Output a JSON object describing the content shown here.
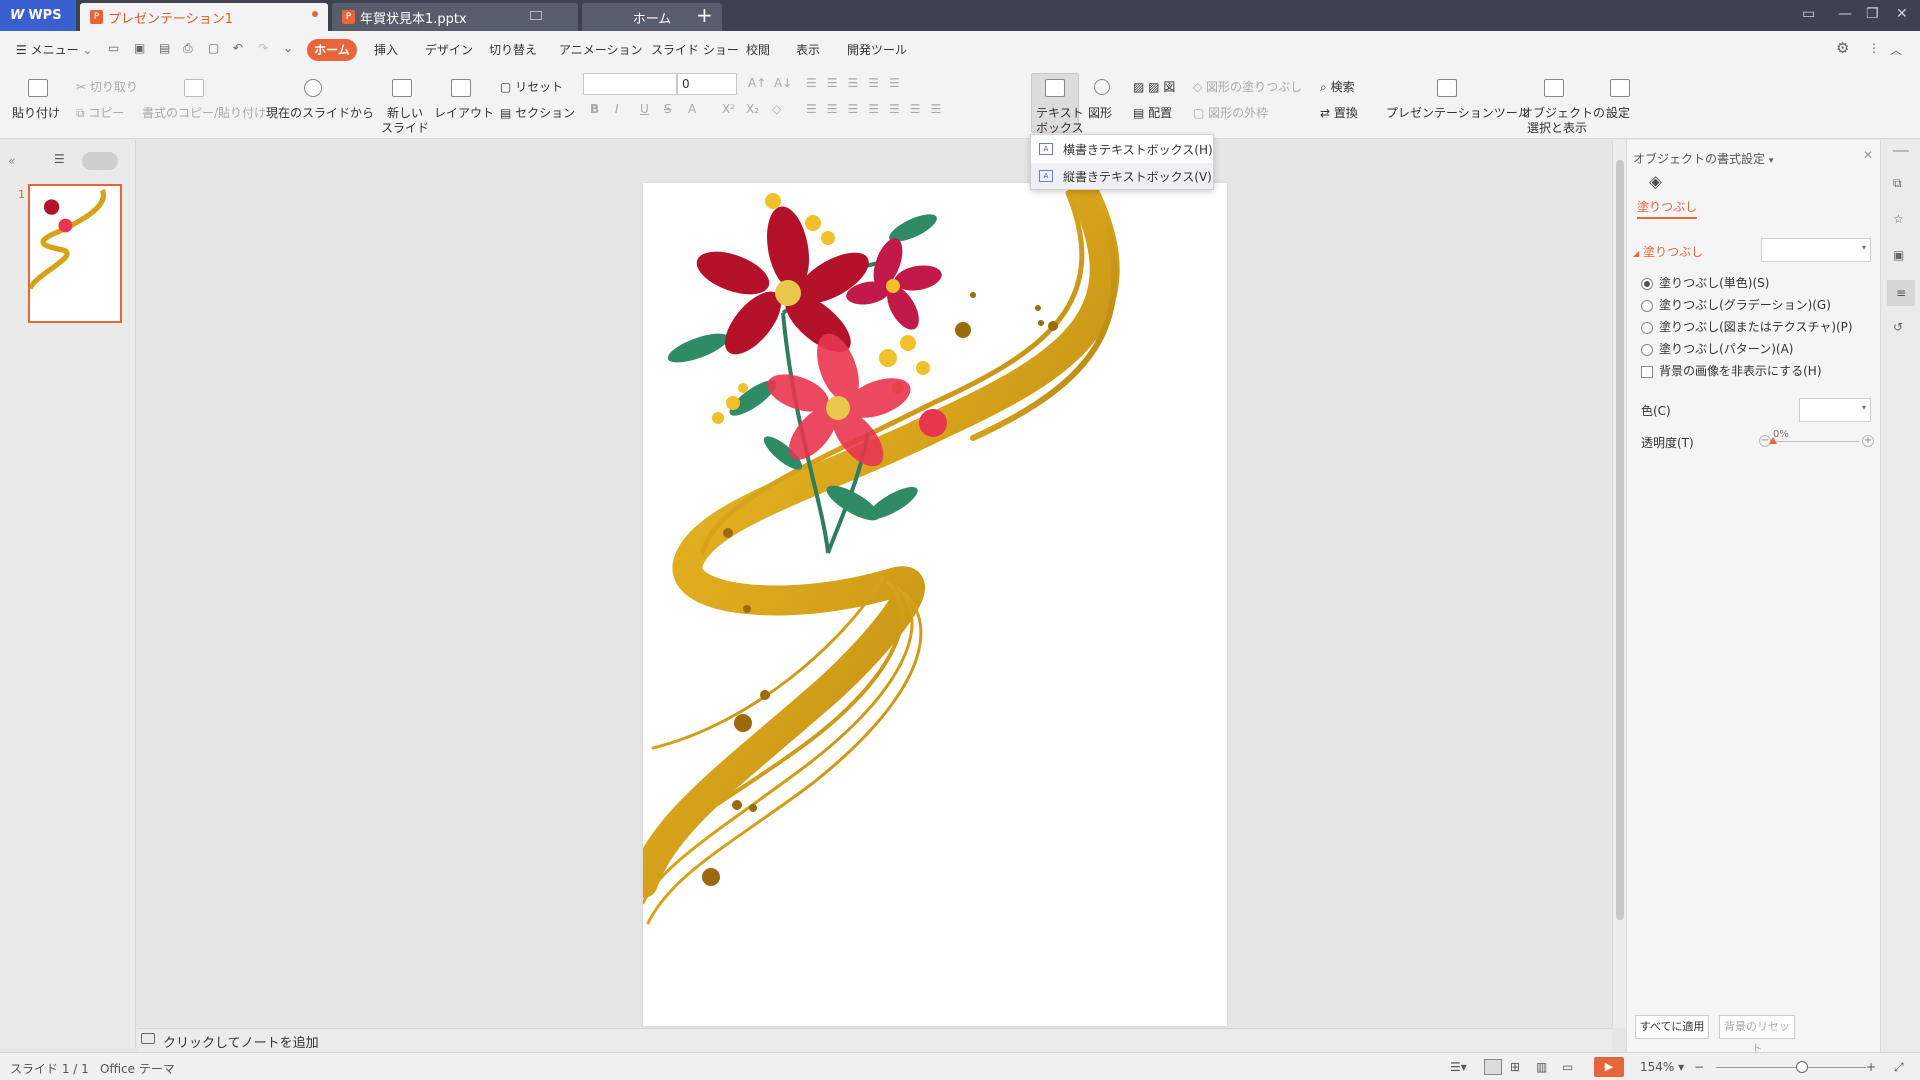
{
  "titlebar": {
    "brand": "WPS",
    "tabs": [
      {
        "label": "プレゼンテーション1"
      },
      {
        "label": "年賀状見本1.pptx"
      },
      {
        "label": "ホーム"
      }
    ],
    "new_tab": "+"
  },
  "menu": {
    "menu_label": "メニュー",
    "tabs": [
      "ホーム",
      "挿入",
      "デザイン",
      "切り替え",
      "アニメーション",
      "スライド ショー",
      "校閲",
      "表示",
      "開発ツール"
    ]
  },
  "ribbon": {
    "paste": "貼り付け",
    "cut": "切り取り",
    "copy": "コピー",
    "format_copy": "書式のコピー/貼り付け",
    "from_current": "現在のスライドから",
    "new_slide_1": "新しい",
    "new_slide_2": "スライド",
    "layout": "レイアウト",
    "reset": "リセット",
    "section": "セクション",
    "font_size": "0",
    "textbox_1": "テキスト",
    "textbox_2": "ボックス",
    "shape": "図形",
    "picture": "図",
    "arrange": "配置",
    "shape_fill": "図形の塗りつぶし",
    "shape_outline": "図形の外枠",
    "find": "検索",
    "replace": "置換",
    "presentation_tools": "プレゼンテーションツール",
    "select_display_1": "オブジェクトの",
    "select_display_2": "選択と表示",
    "settings": "設定"
  },
  "textbox_menu": {
    "horizontal": "横書きテキストボックス(H)",
    "vertical": "縦書きテキストボックス(V)"
  },
  "left_panel": {
    "slide_number": "1"
  },
  "notes": {
    "placeholder": "クリックしてノートを追加"
  },
  "format_panel": {
    "title": "オブジェクトの書式設定",
    "fill_tab": "塗りつぶし",
    "fill_section": "塗りつぶし",
    "options": [
      "塗りつぶし(単色)(S)",
      "塗りつぶし(グラデーション)(G)",
      "塗りつぶし(図またはテクスチャ)(P)",
      "塗りつぶし(パターン)(A)"
    ],
    "hide_bg": "背景の画像を非表示にする(H)",
    "color_label": "色(C)",
    "transparency_label": "透明度(T)",
    "transparency_value": "0%",
    "transparency": 0,
    "apply_all": "すべてに適用",
    "reset_bg": "背景のリセット"
  },
  "status": {
    "slide_info": "スライド 1 / 1",
    "theme": "Office テーマ",
    "zoom": "154%"
  },
  "colors": {
    "accent": "#e8643b",
    "titlebar": "#3d4150",
    "wps_blue": "#3a5fd1",
    "gold": "#d6a21a",
    "flower_red": "#b3122a",
    "flower_pink": "#e8364f"
  }
}
